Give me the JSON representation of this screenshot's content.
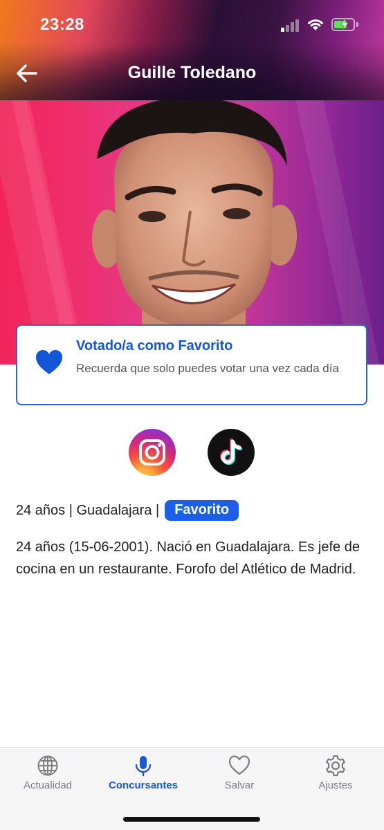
{
  "status_bar": {
    "time": "23:28",
    "icons": [
      "cellular-signal-icon",
      "wifi-icon",
      "battery-charging-icon"
    ]
  },
  "nav": {
    "back_icon": "arrow-left-icon",
    "title": "Guille Toledano"
  },
  "vote_card": {
    "icon": "heart-filled-icon",
    "title": "Votado/a como Favorito",
    "subtitle": "Recuerda que solo puedes votar una vez cada día"
  },
  "social": [
    {
      "name": "instagram",
      "icon": "instagram-icon"
    },
    {
      "name": "tiktok",
      "icon": "tiktok-icon"
    }
  ],
  "profile": {
    "meta": "24 años | Guadalajara |",
    "badge": "Favorito",
    "bio": "24 años (15-06-2001). Nació en Guadalajara. Es jefe de cocina en un restaurante. Forofo del Atlético de Madrid."
  },
  "tabbar": {
    "items": [
      {
        "label": "Actualidad",
        "icon": "globe-icon",
        "active": false
      },
      {
        "label": "Concursantes",
        "icon": "microphone-icon",
        "active": true
      },
      {
        "label": "Salvar",
        "icon": "heart-outline-icon",
        "active": false
      },
      {
        "label": "Ajustes",
        "icon": "gear-icon",
        "active": false
      }
    ]
  },
  "colors": {
    "accent": "#1b5fe8",
    "heart": "#1456d8",
    "battery": "#5ee05a"
  }
}
